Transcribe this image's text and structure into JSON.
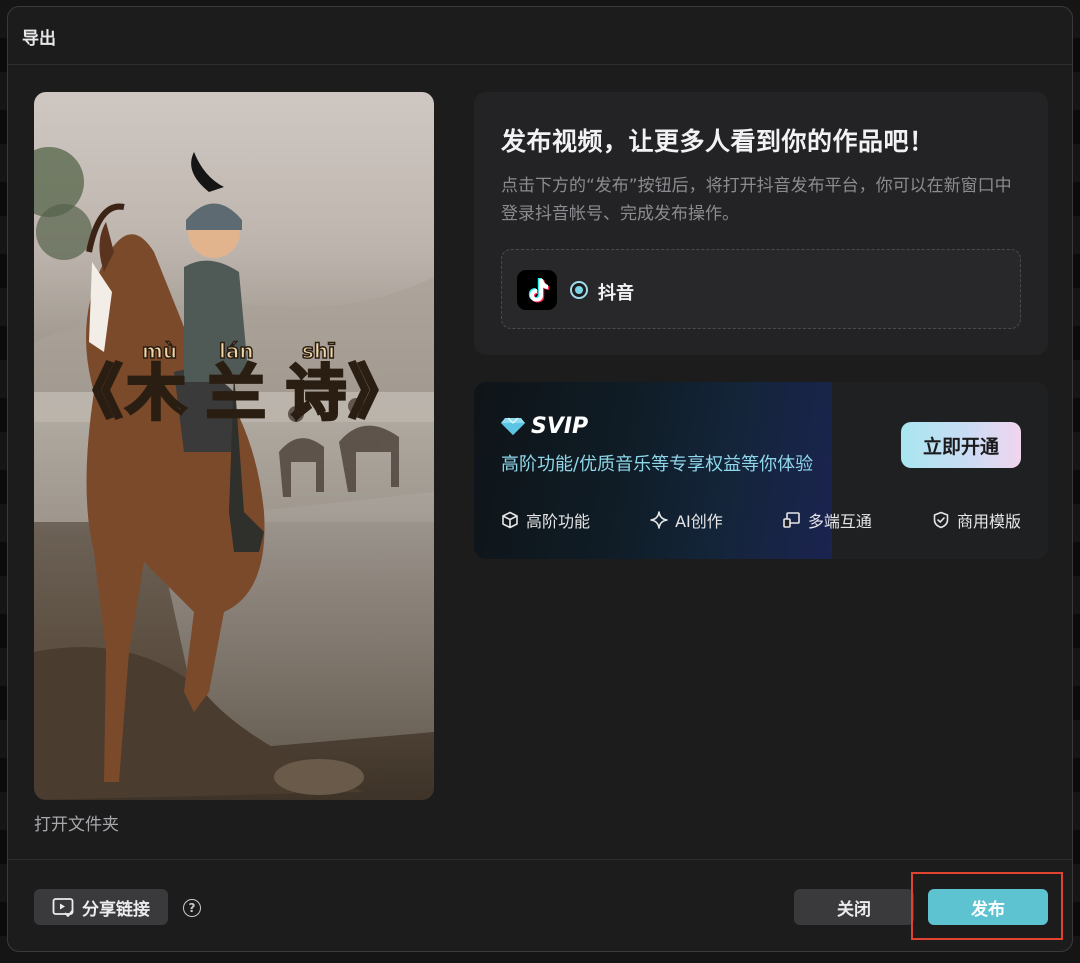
{
  "dialog": {
    "title": "导出"
  },
  "preview": {
    "title_chars": [
      "木",
      "兰",
      "诗"
    ],
    "pinyin": [
      "mù",
      "lán",
      "shī"
    ],
    "open_brackets": "《",
    "close_brackets": "》",
    "open_folder": "打开文件夹"
  },
  "publish": {
    "headline": "发布视频，让更多人看到你的作品吧！",
    "description": "点击下方的“发布”按钮后，将打开抖音发布平台，你可以在新窗口中登录抖音帐号、完成发布操作。",
    "platform": {
      "label": "抖音",
      "selected": true,
      "icon": "tiktok-icon"
    }
  },
  "svip": {
    "badge": "SVIP",
    "subtitle": "高阶功能/优质音乐等专享权益等你体验",
    "activate_label": "立即开通",
    "features": [
      {
        "icon": "cube-icon",
        "label": "高阶功能"
      },
      {
        "icon": "sparkle-icon",
        "label": "AI创作"
      },
      {
        "icon": "devices-icon",
        "label": "多端互通"
      },
      {
        "icon": "shield-check-icon",
        "label": "商用模版"
      }
    ],
    "accent": "#8fd6ea"
  },
  "footer": {
    "share_label": "分享链接",
    "help_label": "?",
    "close_label": "关闭",
    "publish_label": "发布",
    "publish_color": "#5ec3d1"
  }
}
